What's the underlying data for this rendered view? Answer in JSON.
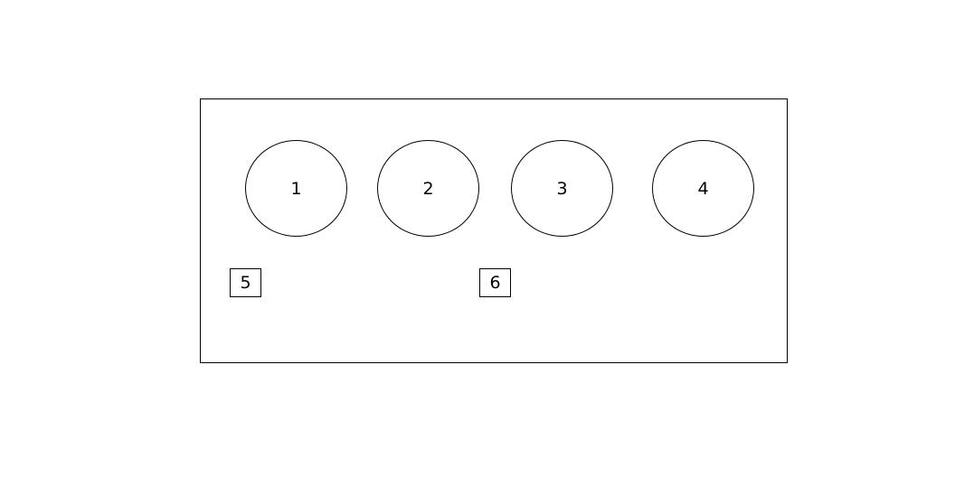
{
  "circles": [
    {
      "label": "1"
    },
    {
      "label": "2"
    },
    {
      "label": "3"
    },
    {
      "label": "4"
    }
  ],
  "boxes": [
    {
      "label": "5"
    },
    {
      "label": "6"
    }
  ]
}
